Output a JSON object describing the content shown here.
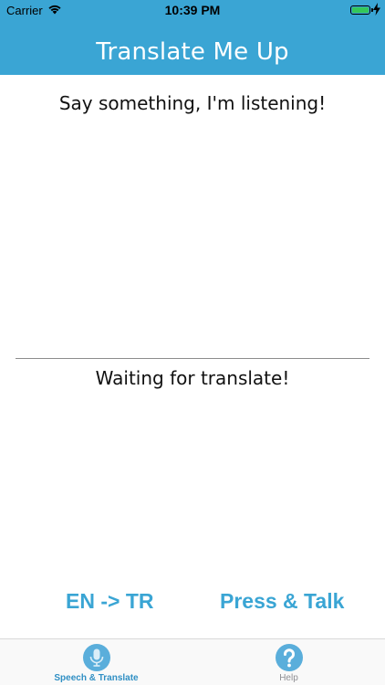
{
  "status_bar": {
    "carrier": "Carrier",
    "time": "10:39 PM",
    "battery_color": "#34c759"
  },
  "nav": {
    "title": "Translate Me Up",
    "background_color": "#3aa5d4"
  },
  "main": {
    "listening_text": "Say something, I'm listening!",
    "translation_text": "Waiting for translate!"
  },
  "actions": {
    "language_label": "EN -> TR",
    "talk_label": "Press & Talk",
    "accent_color": "#3aa5d4"
  },
  "tab_bar": {
    "tabs": [
      {
        "label": "Speech & Translate",
        "icon": "microphone-icon",
        "selected": true
      },
      {
        "label": "Help",
        "icon": "question-mark-icon",
        "selected": false
      }
    ]
  }
}
